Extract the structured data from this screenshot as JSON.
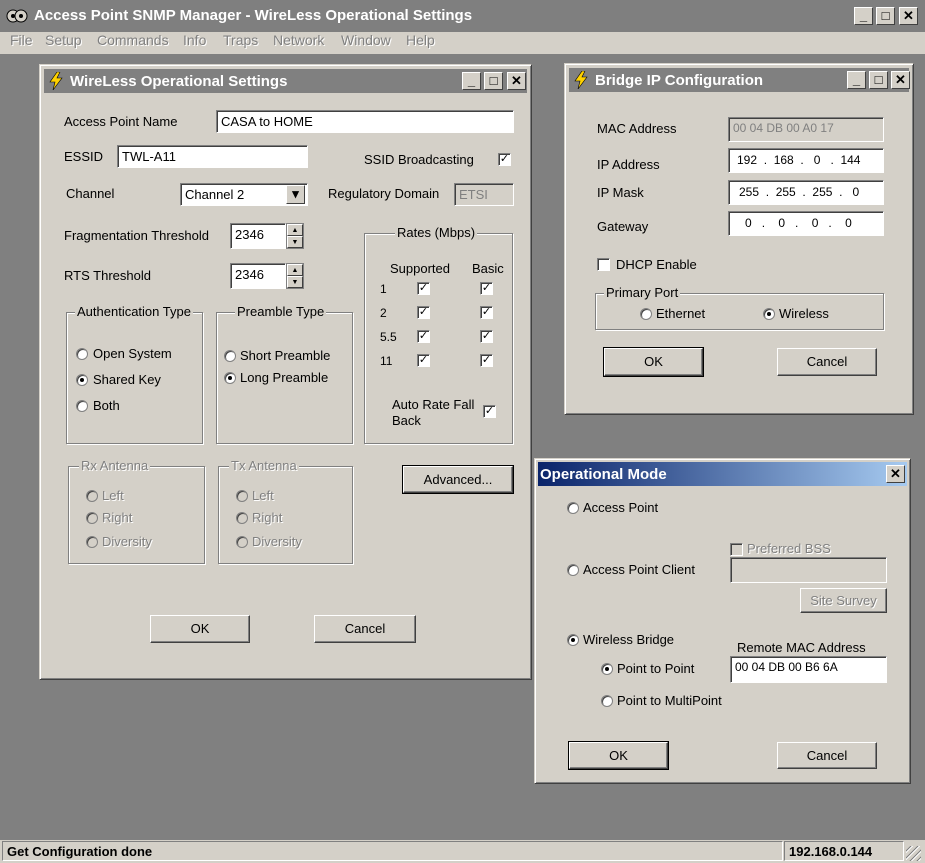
{
  "app": {
    "title": "Access Point SNMP Manager -  WireLess Operational Settings",
    "menu": [
      "File",
      "Setup",
      "Commands",
      "Info",
      "Traps",
      "Network",
      "Window",
      "Help"
    ]
  },
  "wireless": {
    "title": "WireLess Operational Settings",
    "ap_name_label": "Access Point Name",
    "ap_name_value": "CASA to HOME",
    "essid_label": "ESSID",
    "essid_value": "TWL-A11",
    "ssid_broadcast_label": "SSID Broadcasting",
    "channel_label": "Channel",
    "channel_value": "Channel 2",
    "reg_domain_label": "Regulatory Domain",
    "reg_domain_value": "ETSI",
    "frag_label": "Fragmentation Threshold",
    "frag_value": "2346",
    "rts_label": "RTS Threshold",
    "rts_value": "2346",
    "auth": {
      "title": "Authentication Type",
      "options": [
        "Open System",
        "Shared Key",
        "Both"
      ],
      "selected": "Shared Key"
    },
    "preamble": {
      "title": "Preamble Type",
      "options": [
        "Short Preamble",
        "Long Preamble"
      ],
      "selected": "Long Preamble"
    },
    "rates": {
      "title": "Rates (Mbps)",
      "supported_label": "Supported",
      "basic_label": "Basic",
      "rows": [
        "1",
        "2",
        "5.5",
        "11"
      ],
      "auto_label_1": "Auto Rate Fall",
      "auto_label_2": "Back"
    },
    "rx": {
      "title": "Rx Antenna",
      "options": [
        "Left",
        "Right",
        "Diversity"
      ]
    },
    "tx": {
      "title": "Tx Antenna",
      "options": [
        "Left",
        "Right",
        "Diversity"
      ]
    },
    "advanced_label": "Advanced...",
    "ok_label": "OK",
    "cancel_label": "Cancel"
  },
  "bridge": {
    "title": "Bridge IP Configuration",
    "mac_label": "MAC Address",
    "mac_value": "00 04 DB 00 A0 17",
    "ip_label": "IP Address",
    "ip_value": [
      "192",
      "168",
      "0",
      "144"
    ],
    "mask_label": "IP Mask",
    "mask_value": [
      "255",
      "255",
      "255",
      "0"
    ],
    "gw_label": "Gateway",
    "gw_value": [
      "0",
      "0",
      "0",
      "0"
    ],
    "dhcp_label": "DHCP Enable",
    "primary_port_label": "Primary Port",
    "ethernet_label": "Ethernet",
    "wireless_label": "Wireless",
    "ok_label": "OK",
    "cancel_label": "Cancel"
  },
  "opmode": {
    "title": "Operational Mode",
    "ap_label": "Access Point",
    "apc_label": "Access Point Client",
    "preferred_bss_label": "Preferred BSS",
    "site_survey_label": "Site Survey",
    "bridge_label": "Wireless Bridge",
    "remote_mac_label": "Remote MAC Address",
    "remote_mac_value": "00 04 DB 00 B6 6A",
    "p2p_label": "Point to Point",
    "p2mp_label": "Point to MultiPoint",
    "ok_label": "OK",
    "cancel_label": "Cancel"
  },
  "status": {
    "message": "Get Configuration done",
    "ip": "192.168.0.144"
  },
  "window_controls": {
    "min": "_",
    "max": "□",
    "close": "✕"
  }
}
